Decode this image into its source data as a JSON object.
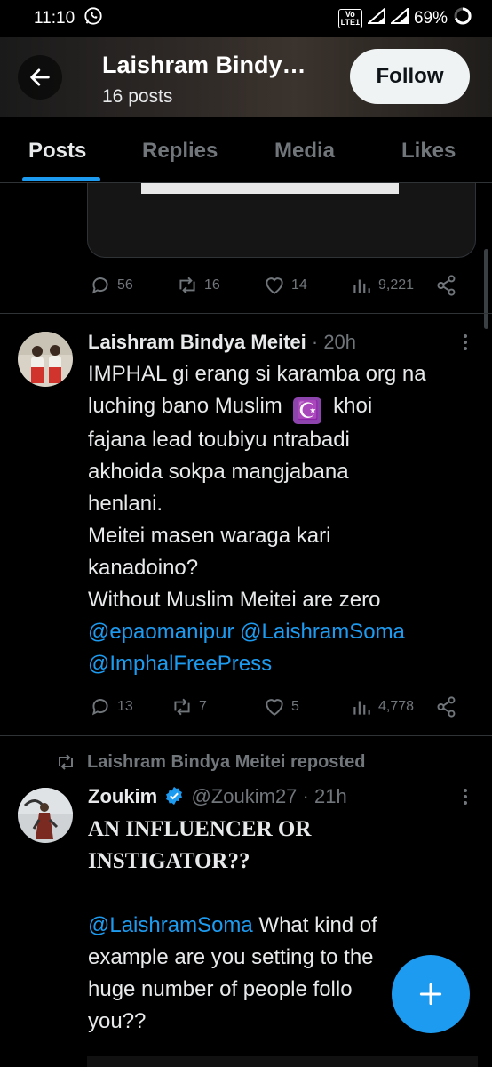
{
  "status_bar": {
    "time": "11:10",
    "battery": "69%",
    "volte": "Vo LTE 1"
  },
  "header": {
    "name": "Laishram Bindy…",
    "posts": "16 posts",
    "follow_label": "Follow"
  },
  "tabs": [
    "Posts",
    "Replies",
    "Media",
    "Likes"
  ],
  "active_tab": "Posts",
  "tweet0": {
    "stats": {
      "replies": "56",
      "reposts": "16",
      "likes": "14",
      "views": "9,221"
    }
  },
  "tweet1": {
    "name": "Laishram Bindya Meitei",
    "time": "· 20h",
    "lines": [
      "IMPHAL gi erang si karamba org na",
      "luching bano Muslim",
      "fajana lead toubiyu ntrabadi",
      "akhoida sokpa mangjabana",
      "henlani.",
      "Meitei masen waraga kari",
      "kanadoino?",
      "Without Muslim Meitei are zero"
    ],
    "line2_tail": "khoi",
    "crescent": "☪️",
    "mention1": "@epaomanipur",
    "mention2": "@LaishramSoma",
    "mention3": "@ImphalFreePress",
    "stats": {
      "replies": "13",
      "reposts": "7",
      "likes": "5",
      "views": "4,778"
    }
  },
  "repost_label": "Laishram Bindya Meitei reposted",
  "tweet2": {
    "name": "Zoukim",
    "handle": "@Zoukim27",
    "time": "· 21h",
    "heading1": "AN INFLUENCER OR",
    "heading2": "INSTIGATOR??",
    "mention": "@LaishramSoma",
    "line1_tail": " What kind of",
    "line2": "example are you setting to the",
    "line3": "huge number of people follo",
    "line4": "you??"
  },
  "colors": {
    "accent": "#1d9bf0",
    "muted": "#71767b",
    "text": "#e7e9ea",
    "background": "#000000"
  },
  "icons": [
    "back-arrow-icon",
    "reply-icon",
    "repost-icon",
    "like-icon",
    "views-icon",
    "share-icon",
    "verified-icon",
    "more-icon",
    "compose-icon"
  ]
}
